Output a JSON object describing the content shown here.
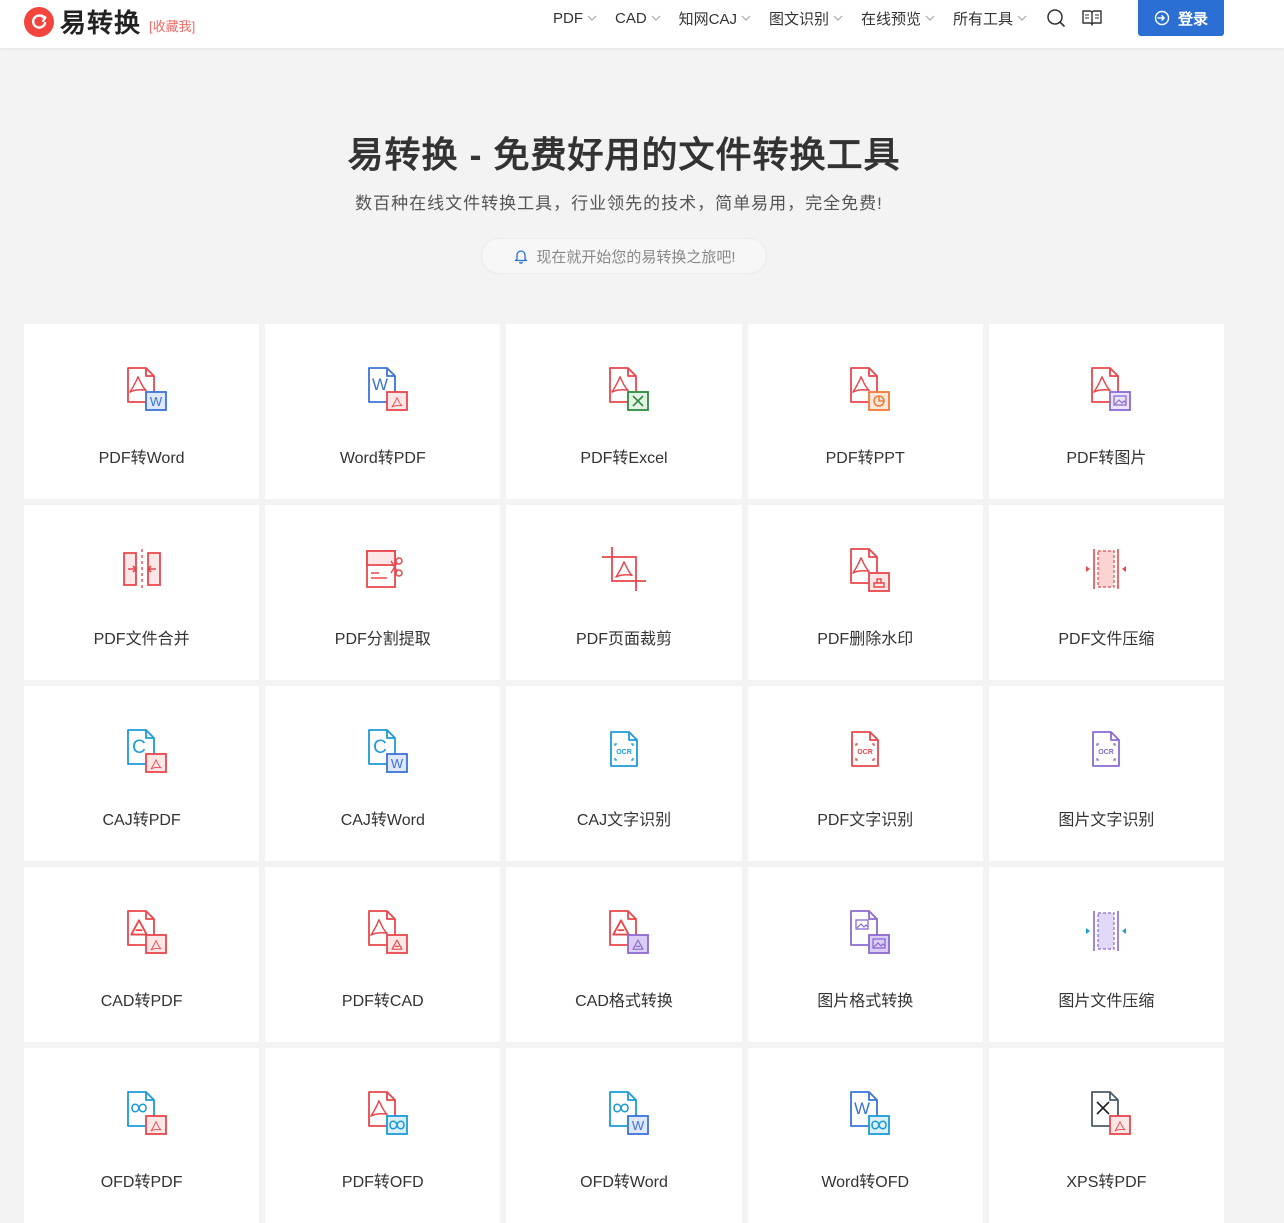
{
  "header": {
    "logo_text": "易转换",
    "favorite": "[收藏我]",
    "nav": [
      {
        "label": "PDF",
        "name": "nav-pdf"
      },
      {
        "label": "CAD",
        "name": "nav-cad"
      },
      {
        "label": "知网CAJ",
        "name": "nav-caj"
      },
      {
        "label": "图文识别",
        "name": "nav-ocr"
      },
      {
        "label": "在线预览",
        "name": "nav-preview"
      },
      {
        "label": "所有工具",
        "name": "nav-all-tools"
      }
    ],
    "login_label": "登录"
  },
  "hero": {
    "title": "易转换 - 免费好用的文件转换工具",
    "subtitle": "数百种在线文件转换工具，行业领先的技术，简单易用，完全免费!",
    "pill": "现在就开始您的易转换之旅吧!"
  },
  "colors": {
    "pdf_red": "#e8474c",
    "word_blue": "#3b73d9",
    "excel_green": "#2e8b3e",
    "ppt_orange": "#f07a3a",
    "purple": "#8a6ad1",
    "caj_cyan": "#1b9bd7",
    "accent_blue": "#2b6fd4"
  },
  "tools": [
    {
      "label": "PDF转Word",
      "icon": "pdf-to-word-icon"
    },
    {
      "label": "Word转PDF",
      "icon": "word-to-pdf-icon"
    },
    {
      "label": "PDF转Excel",
      "icon": "pdf-to-excel-icon"
    },
    {
      "label": "PDF转PPT",
      "icon": "pdf-to-ppt-icon"
    },
    {
      "label": "PDF转图片",
      "icon": "pdf-to-image-icon"
    },
    {
      "label": "PDF文件合并",
      "icon": "pdf-merge-icon"
    },
    {
      "label": "PDF分割提取",
      "icon": "pdf-split-icon"
    },
    {
      "label": "PDF页面裁剪",
      "icon": "pdf-crop-icon"
    },
    {
      "label": "PDF删除水印",
      "icon": "pdf-remove-watermark-icon"
    },
    {
      "label": "PDF文件压缩",
      "icon": "pdf-compress-icon"
    },
    {
      "label": "CAJ转PDF",
      "icon": "caj-to-pdf-icon"
    },
    {
      "label": "CAJ转Word",
      "icon": "caj-to-word-icon"
    },
    {
      "label": "CAJ文字识别",
      "icon": "caj-ocr-icon"
    },
    {
      "label": "PDF文字识别",
      "icon": "pdf-ocr-icon"
    },
    {
      "label": "图片文字识别",
      "icon": "image-ocr-icon"
    },
    {
      "label": "CAD转PDF",
      "icon": "cad-to-pdf-icon"
    },
    {
      "label": "PDF转CAD",
      "icon": "pdf-to-cad-icon"
    },
    {
      "label": "CAD格式转换",
      "icon": "cad-format-icon"
    },
    {
      "label": "图片格式转换",
      "icon": "image-format-icon"
    },
    {
      "label": "图片文件压缩",
      "icon": "image-compress-icon"
    },
    {
      "label": "OFD转PDF",
      "icon": "ofd-to-pdf-icon"
    },
    {
      "label": "PDF转OFD",
      "icon": "pdf-to-ofd-icon"
    },
    {
      "label": "OFD转Word",
      "icon": "ofd-to-word-icon"
    },
    {
      "label": "Word转OFD",
      "icon": "word-to-ofd-icon"
    },
    {
      "label": "XPS转PDF",
      "icon": "xps-to-pdf-icon"
    }
  ]
}
